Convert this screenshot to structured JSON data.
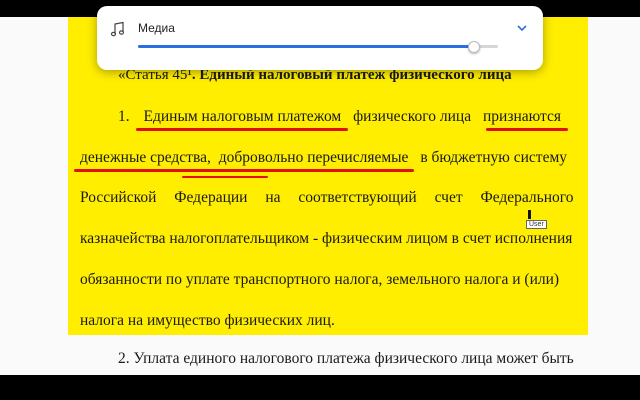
{
  "media": {
    "title": "Медиа",
    "icon": "music-note-icon",
    "expand_icon": "chevron-down-icon",
    "volume_level": 0.93,
    "accent_color": "#2a6fe0"
  },
  "document": {
    "heading_prefix": "«Статья 45",
    "heading_sup": "¹",
    "heading_title": ". Единый налоговый платеж физического лица",
    "p1": {
      "num": "1.",
      "w1": "Единым налоговым платежом",
      "w2": "физического лица",
      "w3": "признаются"
    },
    "p2": {
      "w1": "денежные средства,",
      "w2": "добровольно перечисляемые",
      "w3": "в бюджетную систему"
    },
    "line3": "Российской Федерации на соответствующий счет Федерального",
    "line4": "казначейства налогоплательщиком - физическим лицом в счет исполнения",
    "line5": "обязанности по уплате транспортного налога, земельного налога и (или)",
    "line6": "налога на имущество физических лиц.",
    "line7": "2. Уплата единого налогового платежа физического лица может быть",
    "cursor_tag": "User",
    "highlight_color": "#ffee00",
    "underline_color": "#e01010"
  }
}
